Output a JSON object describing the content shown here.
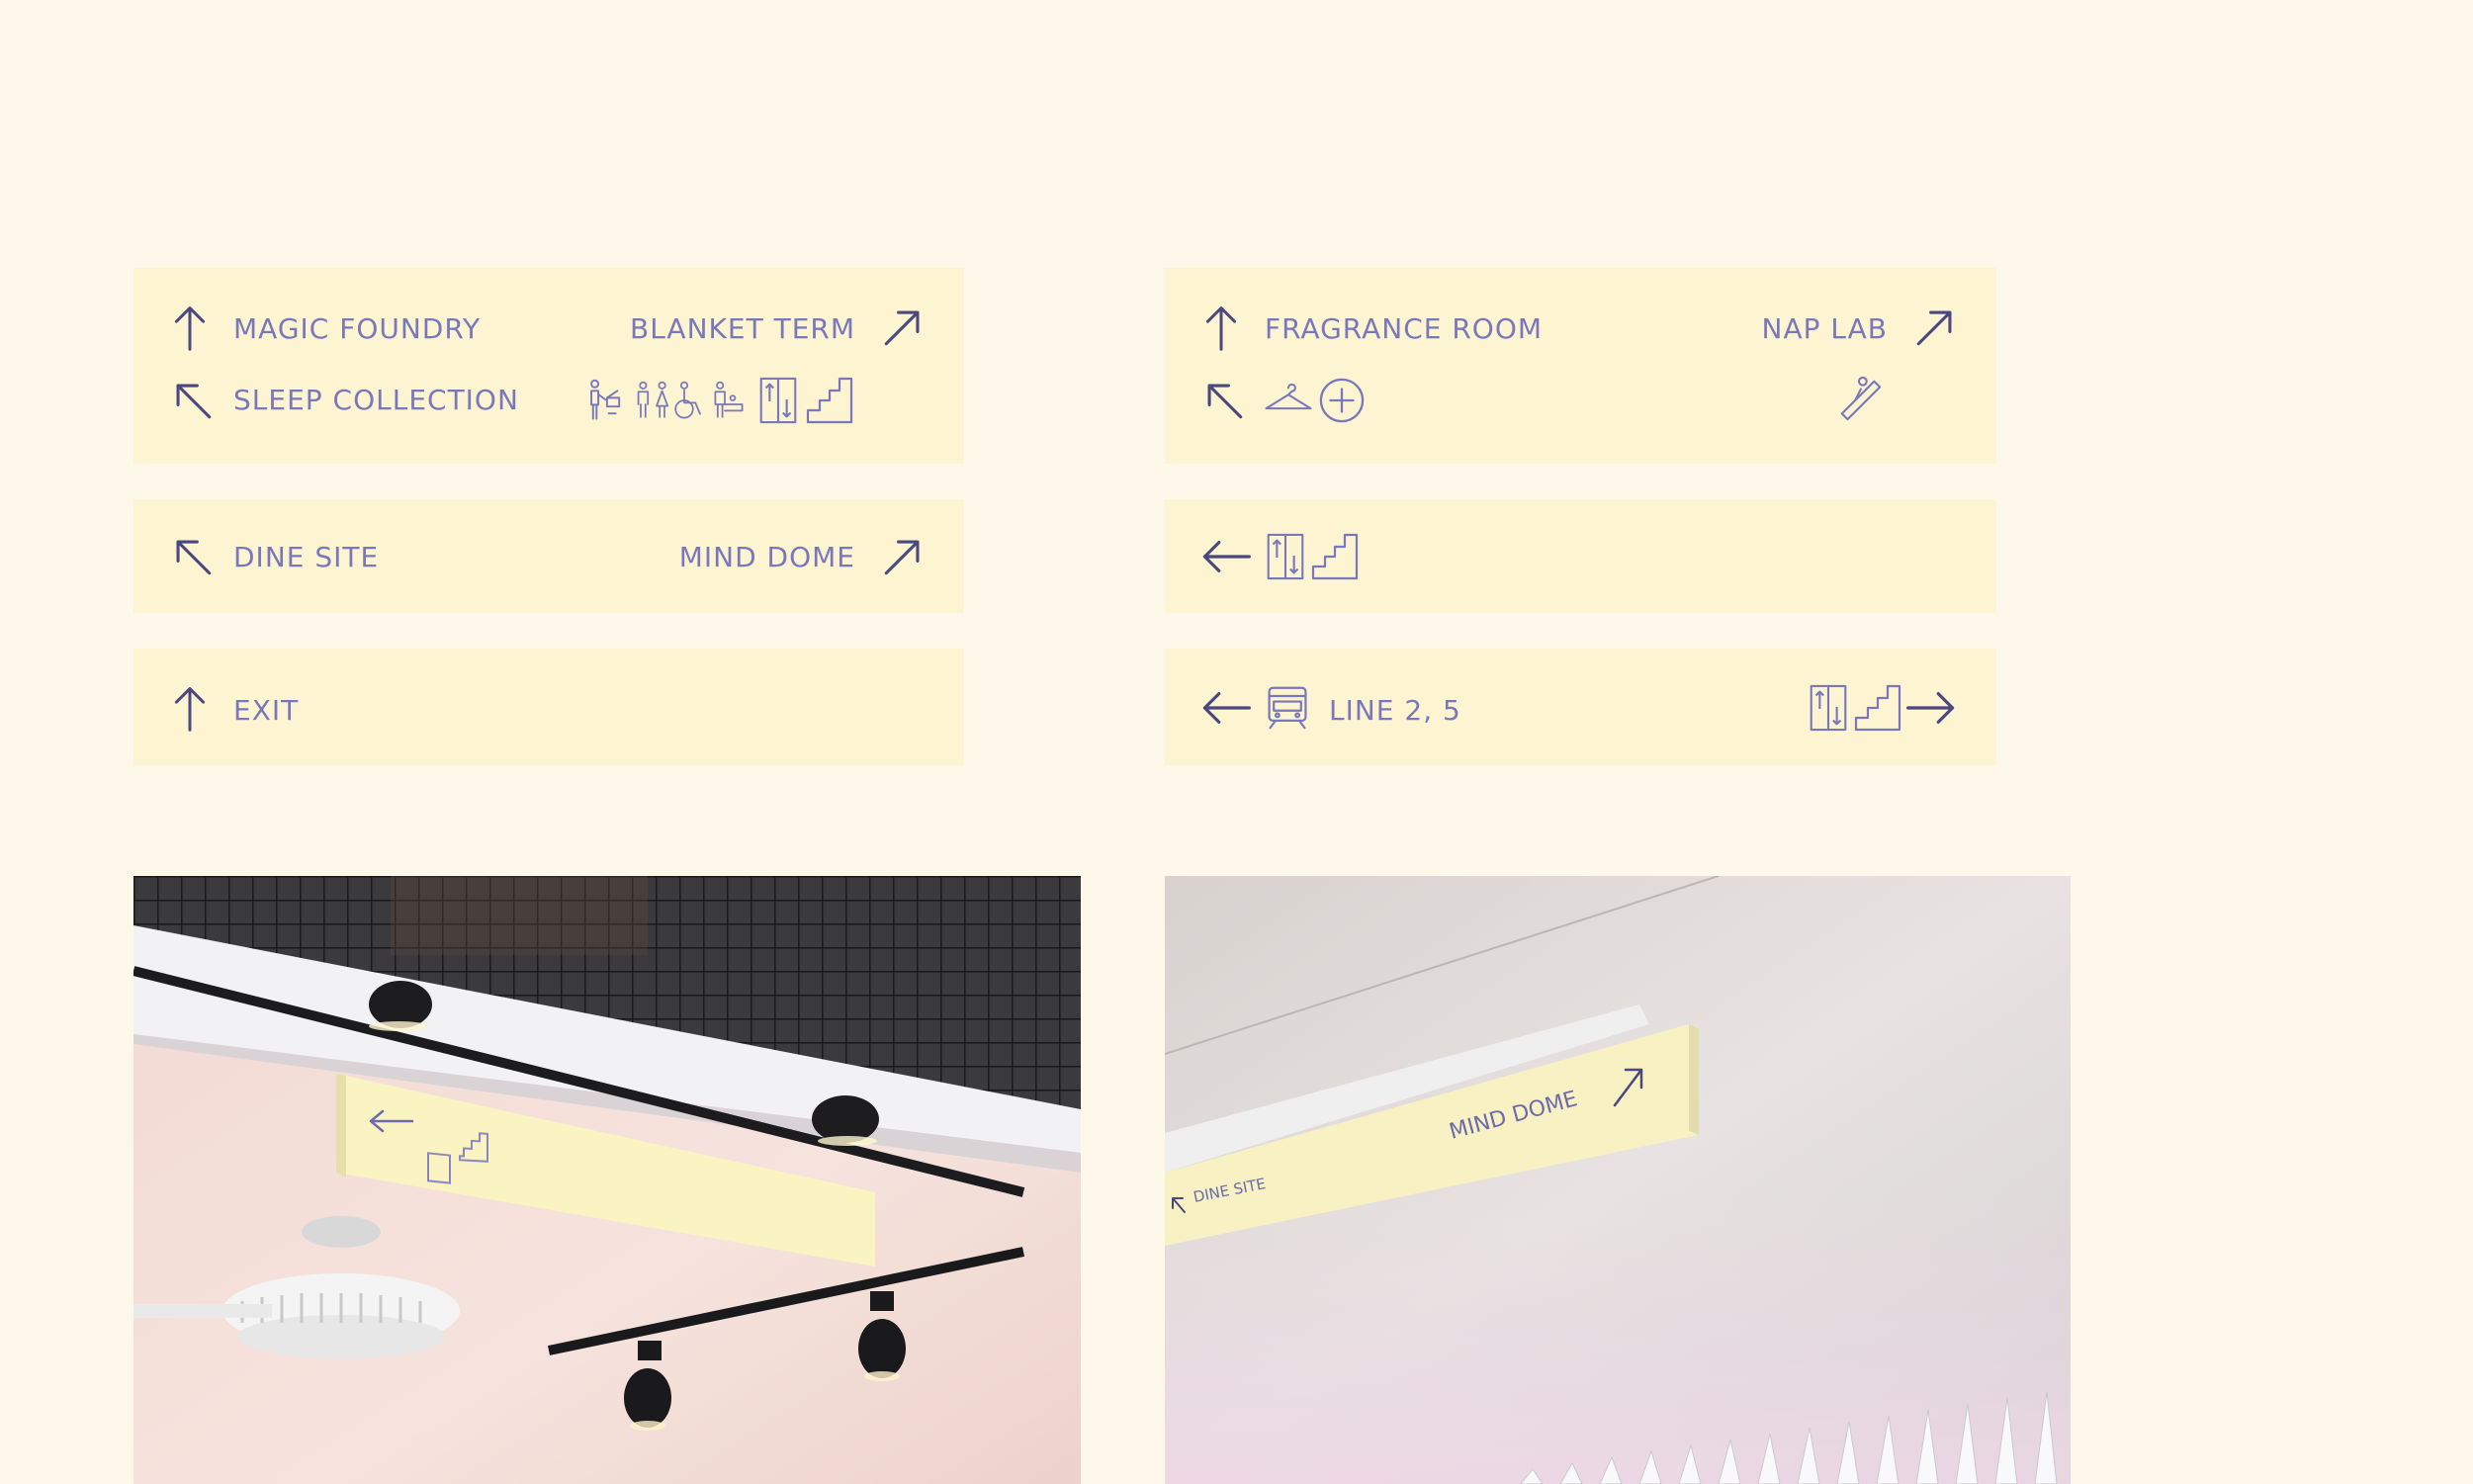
{
  "signs": {
    "sign1": {
      "row1_left": "MAGIC FOUNDRY",
      "row1_right": "BLANKET TERM",
      "row2_left": "SLEEP COLLECTION",
      "row2_icons": [
        "baggage-icon",
        "restroom-icon",
        "accessible-restroom-icon",
        "baby-care-icon",
        "elevator-icon",
        "stairs-icon"
      ]
    },
    "sign2": {
      "row1_left": "FRAGRANCE ROOM",
      "row1_right": "NAP LAB",
      "row2_icons": [
        "cloakroom-icon",
        "first-aid-icon",
        "escalator-icon"
      ]
    },
    "sign3": {
      "left": "DINE SITE",
      "right": "MIND DOME"
    },
    "sign4": {
      "icons": [
        "elevator-icon",
        "stairs-icon"
      ]
    },
    "sign5": {
      "left": "EXIT"
    },
    "sign6": {
      "left": "LINE 2, 5",
      "icons": [
        "train-icon",
        "elevator-icon",
        "stairs-icon"
      ]
    }
  },
  "photos": {
    "photo1": {
      "description_icons": [
        "elevator-icon",
        "stairs-icon"
      ]
    },
    "photo2": {
      "sign_left": "DINE SITE",
      "sign_right": "MIND DOME"
    }
  },
  "colors": {
    "background": "#fdf8ea",
    "sign_panel": "#fdf5d2",
    "ink": "#4b4880",
    "label": "#7a77bb"
  }
}
